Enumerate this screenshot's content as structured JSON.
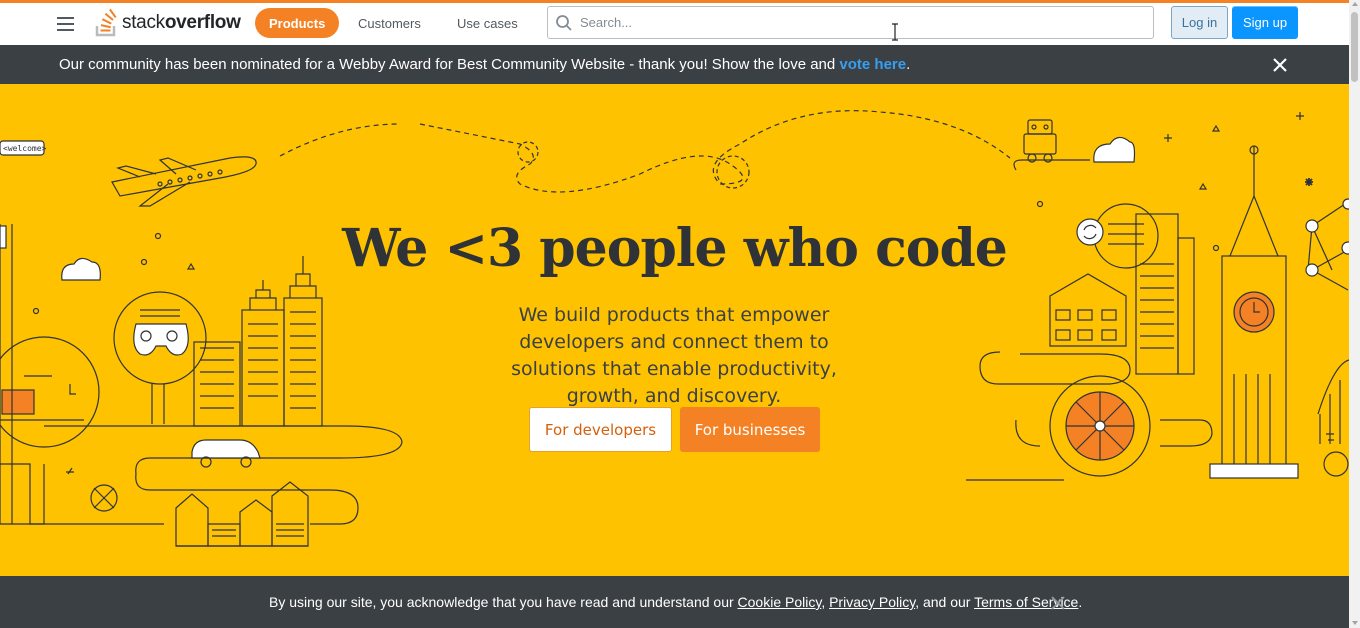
{
  "header": {
    "menu_icon": "hamburger-icon",
    "logo": {
      "prefix": "stack",
      "bold": "overflow"
    },
    "nav": [
      {
        "label": "Products",
        "active": true
      },
      {
        "label": "Customers",
        "active": false
      },
      {
        "label": "Use cases",
        "active": false
      }
    ],
    "search": {
      "placeholder": "Search...",
      "value": "",
      "icon": "search-icon"
    },
    "login_label": "Log in",
    "signup_label": "Sign up"
  },
  "notice": {
    "text": "Our community has been nominated for a Webby Award for Best Community Website - thank you! Show the love and ",
    "link": "vote here",
    "suffix": ".",
    "close_icon": "close-icon"
  },
  "hero": {
    "title": "We <3 people who code",
    "subtitle": "We build products that empower developers and connect them to solutions that enable productivity, growth, and discovery.",
    "button_developers": "For developers",
    "button_businesses": "For businesses",
    "art_tag": "<welcome>"
  },
  "cookie": {
    "text_before": "By using our site, you acknowledge that you have read and understand our ",
    "cookie_policy": "Cookie Policy",
    "sep1": ", ",
    "privacy_policy": "Privacy Policy",
    "sep2": ", and our ",
    "terms": "Terms of Service",
    "sep3": ".",
    "close_icon": "close-icon"
  },
  "colors": {
    "brand_orange": "#f48225",
    "hero_yellow": "#ffc200",
    "dark_bar": "#3b4045",
    "link_blue": "#379fef",
    "signup_blue": "#0a95ff"
  }
}
